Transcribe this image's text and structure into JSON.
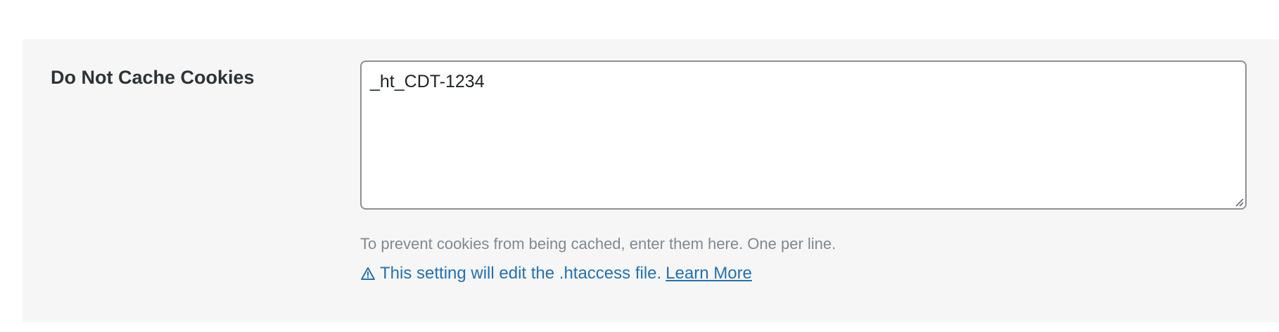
{
  "setting": {
    "label": "Do Not Cache Cookies",
    "textarea_value": "_ht_CDT-1234",
    "help_text": "To prevent cookies from being cached, enter them here. One per line.",
    "notice_text": "This setting will edit the .htaccess file.",
    "learn_more_label": "Learn More",
    "warning_icon": "warning-triangle-icon"
  },
  "colors": {
    "panel_bg": "#f6f6f6",
    "label": "#2c3338",
    "help": "#7e8993",
    "link": "#2271b1",
    "border": "#8c8f94"
  }
}
